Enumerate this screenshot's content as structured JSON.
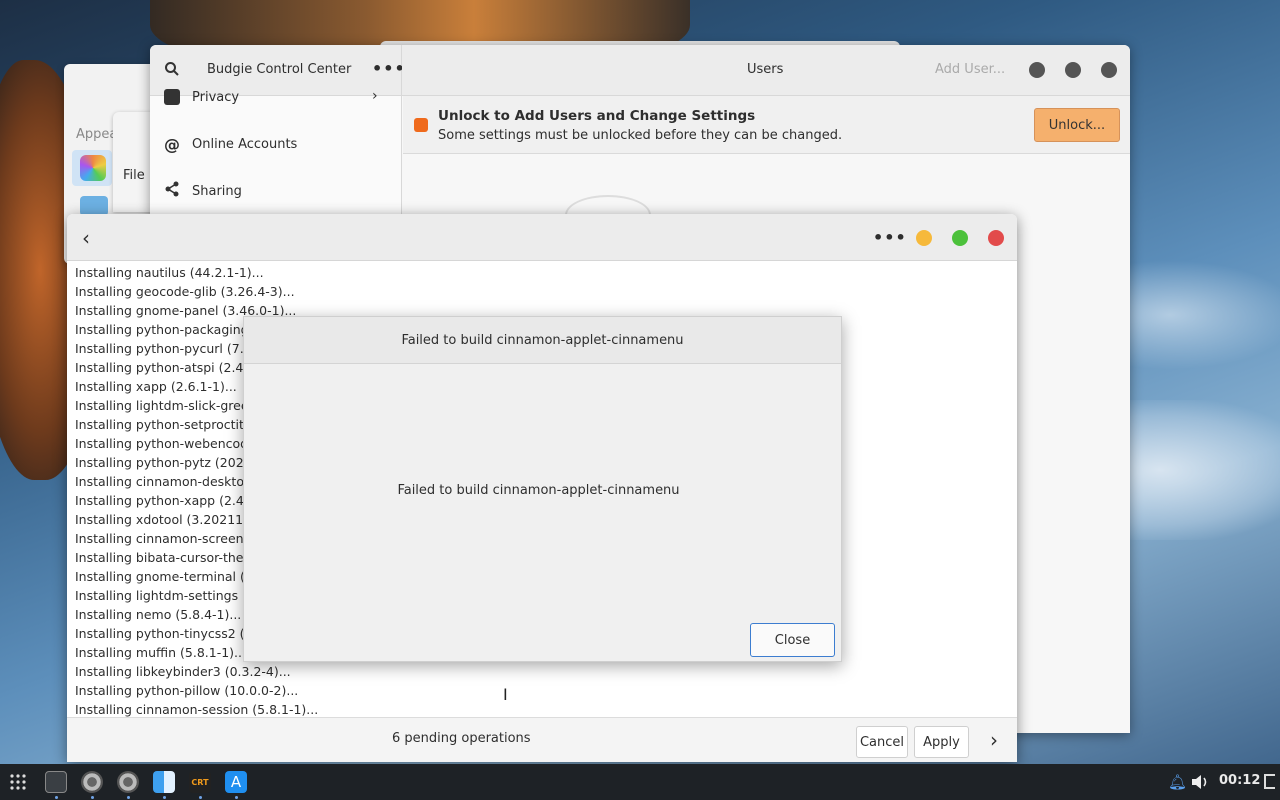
{
  "budgie": {
    "title": "Budgie Control Center",
    "page_title": "Users",
    "add_user": "Add User...",
    "sidebar": [
      {
        "label": "Privacy"
      },
      {
        "label": "Online Accounts"
      },
      {
        "label": "Sharing"
      }
    ],
    "banner_title": "Unlock to Add Users and Change Settings",
    "banner_subtitle": "Some settings must be unlocked before they can be changed.",
    "unlock_label": "Unlock..."
  },
  "backwin": {
    "appearance_partial": "Appea",
    "file_partial": "File"
  },
  "installer": {
    "log": [
      "Installing nautilus (44.2.1-1)...",
      "Installing geocode-glib (3.26.4-3)...",
      "Installing gnome-panel (3.46.0-1)...",
      "Installing python-packaging",
      "Installing python-pycurl (7.4",
      "Installing python-atspi (2.46",
      "Installing xapp (2.6.1-1)...",
      "Installing lightdm-slick-gree",
      "Installing python-setproctit",
      "Installing python-webencod",
      "Installing python-pytz (2023",
      "Installing cinnamon-desktop",
      "Installing python-xapp (2.4.",
      "Installing xdotool (3.202110",
      "Installing cinnamon-screens",
      "Installing bibata-cursor-the",
      "Installing gnome-terminal (",
      "Installing lightdm-settings (",
      "Installing nemo (5.8.4-1)...",
      "Installing python-tinycss2 (1",
      "Installing muffin (5.8.1-1)...",
      "Installing libkeybinder3 (0.3.2-4)...",
      "Installing python-pillow (10.0.0-2)...",
      "Installing cinnamon-session (5.8.1-1)..."
    ],
    "pending": "6 pending operations",
    "cancel_label": "Cancel",
    "apply_label": "Apply"
  },
  "dialog": {
    "title": "Failed to build cinnamon-applet-cinnamenu",
    "message": "Failed to build cinnamon-applet-cinnamenu",
    "close_label": "Close"
  },
  "taskbar": {
    "clock": "00:12"
  },
  "colors": {
    "accent": "#3c7dd0",
    "warning": "#ef6a1c",
    "unlock_button": "#f5b06d",
    "minimize": "#f6b93b",
    "maximize": "#4cc13b",
    "close": "#e24b4b"
  }
}
